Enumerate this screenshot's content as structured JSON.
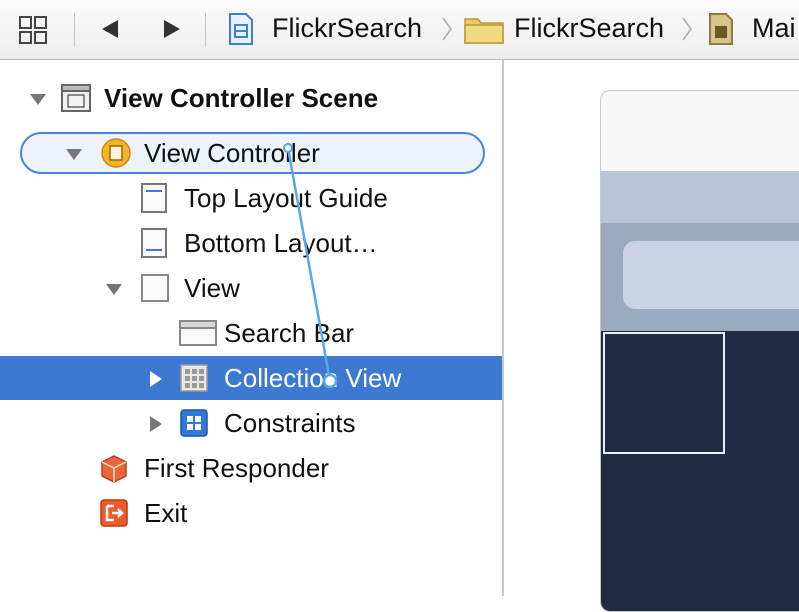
{
  "jump_bar": {
    "crumbs": [
      {
        "label": "FlickrSearch",
        "icon": "project-file-icon"
      },
      {
        "label": "FlickrSearch",
        "icon": "folder-icon"
      },
      {
        "label": "Mai",
        "icon": "storyboard-file-icon"
      }
    ]
  },
  "outline": {
    "rows": [
      {
        "label": "View Controller Scene",
        "icon": "scene-icon",
        "disclosure": "expanded",
        "bold": true
      },
      {
        "label": "View Controller",
        "icon": "view-controller-icon",
        "disclosure": "expanded"
      },
      {
        "label": "Top Layout Guide",
        "icon": "top-layout-guide-icon"
      },
      {
        "label": "Bottom Layout…",
        "icon": "bottom-layout-guide-icon"
      },
      {
        "label": "View",
        "icon": "view-icon",
        "disclosure": "expanded"
      },
      {
        "label": "Search Bar",
        "icon": "search-bar-icon"
      },
      {
        "label": "Collection View",
        "icon": "collection-view-icon",
        "disclosure": "collapsed",
        "selected": true
      },
      {
        "label": "Constraints",
        "icon": "constraints-icon",
        "disclosure": "collapsed"
      },
      {
        "label": "First Responder",
        "icon": "first-responder-icon"
      },
      {
        "label": "Exit",
        "icon": "exit-icon"
      }
    ]
  },
  "colors": {
    "selection": "#3d78d1",
    "connection_line": "#5aa6e8",
    "collection_background": "#1f2b44"
  }
}
